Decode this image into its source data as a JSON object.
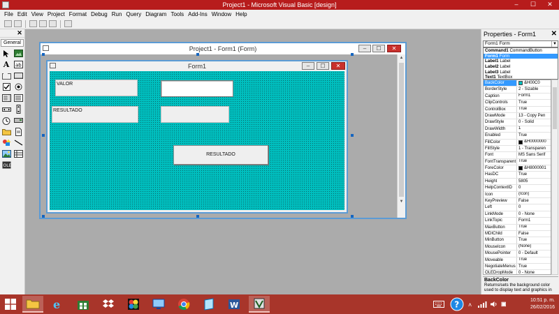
{
  "window": {
    "title": "Project1 - Microsoft Visual Basic [design]",
    "minimize": "–",
    "maximize": "☐",
    "close": "✕"
  },
  "menu": [
    "File",
    "Edit",
    "View",
    "Project",
    "Format",
    "Debug",
    "Run",
    "Query",
    "Diagram",
    "Tools",
    "Add-Ins",
    "Window",
    "Help"
  ],
  "toolbox": {
    "tab": "General",
    "close": "✕"
  },
  "project_window": {
    "title": "Project1 - Form1 (Form)"
  },
  "form": {
    "title": "Form1",
    "controls": {
      "label_valor": "VALOR",
      "label_resultado": "RESULTADO",
      "button_resultado": "RESULTADO"
    }
  },
  "properties": {
    "title": "Properties - Form1",
    "close": "✕",
    "selected_object": "Form1 Form",
    "dropdown_items": [
      {
        "name": "Command1",
        "type": "CommandButton"
      },
      {
        "name": "Form1",
        "type": "Form"
      },
      {
        "name": "Label1",
        "type": "Label"
      },
      {
        "name": "Label2",
        "type": "Label"
      },
      {
        "name": "Label3",
        "type": "Label"
      },
      {
        "name": "Text1",
        "type": "TextBox"
      }
    ],
    "rows": [
      {
        "name": "BackColor",
        "value": "&H00C0",
        "swatch": "#00bfbf",
        "selected": true
      },
      {
        "name": "BorderStyle",
        "value": "2 - Sizable"
      },
      {
        "name": "Caption",
        "value": "Form1"
      },
      {
        "name": "ClipControls",
        "value": "True"
      },
      {
        "name": "ControlBox",
        "value": "True"
      },
      {
        "name": "DrawMode",
        "value": "13 - Copy Pen"
      },
      {
        "name": "DrawStyle",
        "value": "0 - Solid"
      },
      {
        "name": "DrawWidth",
        "value": "1"
      },
      {
        "name": "Enabled",
        "value": "True"
      },
      {
        "name": "FillColor",
        "value": "&H0000000",
        "swatch": "#000000"
      },
      {
        "name": "FillStyle",
        "value": "1 - Transparen"
      },
      {
        "name": "Font",
        "value": "MS Sans Serif"
      },
      {
        "name": "FontTransparent",
        "value": "True"
      },
      {
        "name": "ForeColor",
        "value": "&H8000001",
        "swatch": "#000000"
      },
      {
        "name": "HasDC",
        "value": "True"
      },
      {
        "name": "Height",
        "value": "5805"
      },
      {
        "name": "HelpContextID",
        "value": "0"
      },
      {
        "name": "Icon",
        "value": "(Icon)"
      },
      {
        "name": "KeyPreview",
        "value": "False"
      },
      {
        "name": "Left",
        "value": "0"
      },
      {
        "name": "LinkMode",
        "value": "0 - None"
      },
      {
        "name": "LinkTopic",
        "value": "Form1"
      },
      {
        "name": "MaxButton",
        "value": "True"
      },
      {
        "name": "MDIChild",
        "value": "False"
      },
      {
        "name": "MinButton",
        "value": "True"
      },
      {
        "name": "MouseIcon",
        "value": "(None)"
      },
      {
        "name": "MousePointer",
        "value": "0 - Default"
      },
      {
        "name": "Moveable",
        "value": "True"
      },
      {
        "name": "NegotiateMenus",
        "value": "True"
      },
      {
        "name": "OLEDropMode",
        "value": "0 - None"
      }
    ],
    "description_title": "BackColor",
    "description_text": "Returns/sets the background color used to display text and graphics in"
  },
  "taskbar": {
    "time": "10:51 p. m.",
    "date": "26/02/2016"
  },
  "colors": {
    "title_bar": "#b71c1c",
    "form_background": "#00bfbf",
    "taskbar": "#a8352a",
    "selection": "#3399ff"
  }
}
